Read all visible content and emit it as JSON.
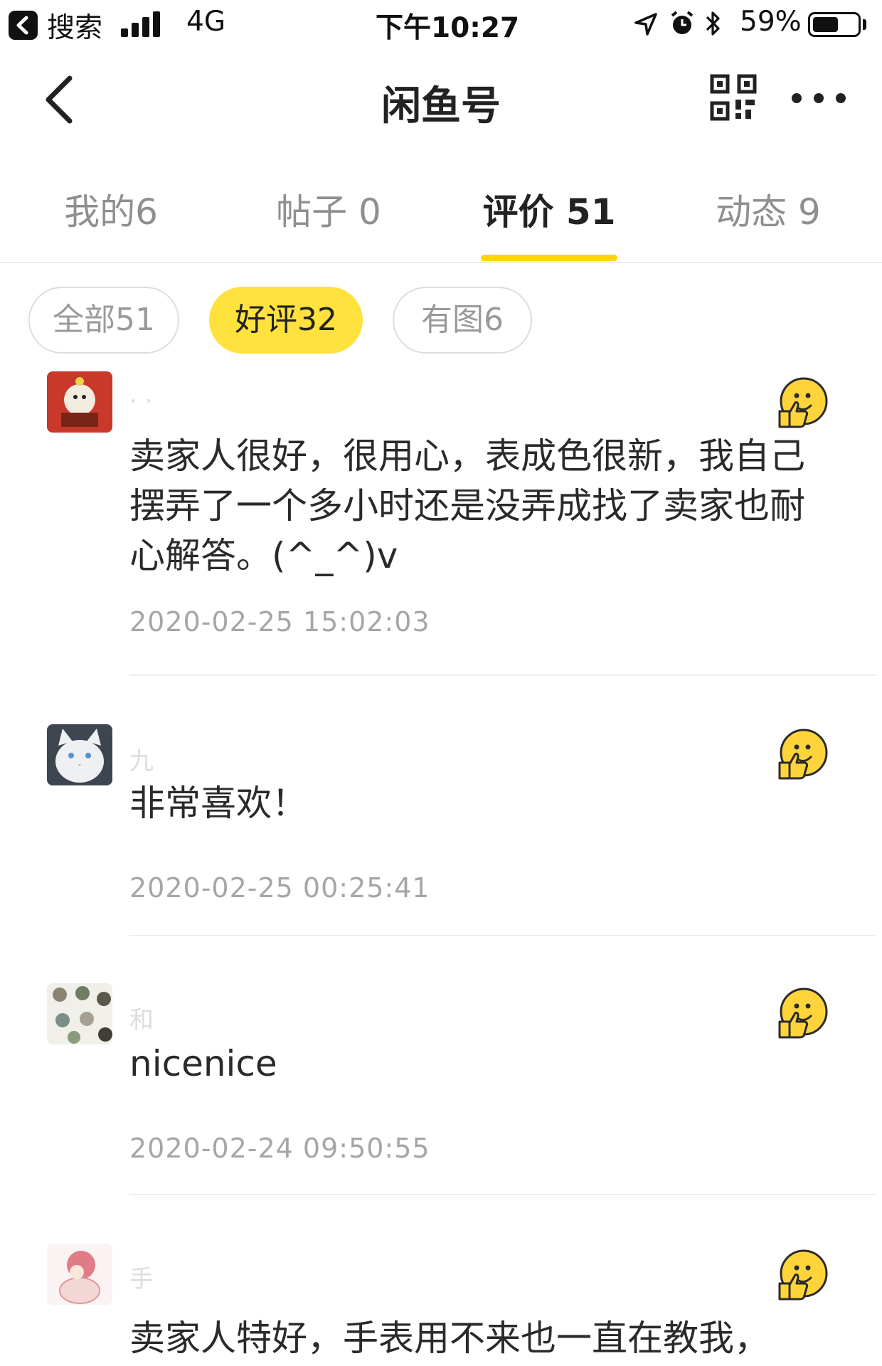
{
  "status_bar": {
    "back_app": "搜索",
    "network": "4G",
    "time": "下午10:27",
    "battery": "59%",
    "battery_level": 0.59
  },
  "nav": {
    "title": "闲鱼号"
  },
  "tabs": [
    {
      "label": "我的6"
    },
    {
      "label": "帖子 0"
    },
    {
      "label": "评价 51"
    },
    {
      "label": "动态 9"
    }
  ],
  "filters": [
    {
      "label": "全部51"
    },
    {
      "label": "好评32"
    },
    {
      "label": "有图6"
    }
  ],
  "reviews": [
    {
      "username": "·  ·",
      "content": "卖家人很好，很用心，表成色很新，我自己摆弄了一个多小时还是没弄成找了卖家也耐心解答。(^_^)v",
      "time": "2020-02-25 15:02:03"
    },
    {
      "username": "九",
      "content": "非常喜欢！",
      "time": "2020-02-25 00:25:41"
    },
    {
      "username": "和",
      "content": "nicenice",
      "time": "2020-02-24 09:50:55"
    },
    {
      "username": "手",
      "content": "卖家人特好，手表用不来也一直在教我，",
      "time": ""
    }
  ],
  "colors": {
    "accent": "#ffd400",
    "chip_active": "#ffe23e",
    "muted_text": "#a6a6a6"
  }
}
